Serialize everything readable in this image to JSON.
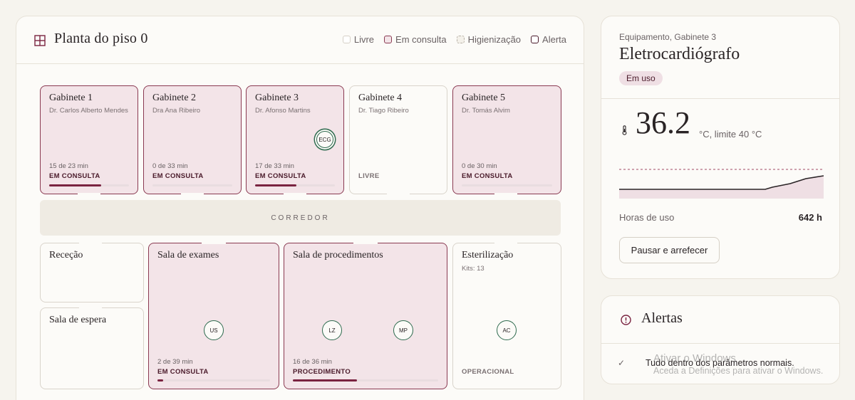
{
  "floor": {
    "title": "Planta do piso 0",
    "legend": [
      "Livre",
      "Em consulta",
      "Higienização",
      "Alerta"
    ],
    "corridor": "CORREDOR",
    "gabinetes": [
      {
        "name": "Gabinete 1",
        "doctor": "Dr. Carlos Alberto Mendes",
        "time": "15 de 23 min",
        "status": "EM CONSULTA",
        "progress": 0.65
      },
      {
        "name": "Gabinete 2",
        "doctor": "Dra Ana Ribeiro",
        "time": "0 de 33 min",
        "status": "EM CONSULTA",
        "progress": 0.0
      },
      {
        "name": "Gabinete 3",
        "doctor": "Dr. Afonso Martins",
        "time": "17 de 33 min",
        "status": "EM CONSULTA",
        "progress": 0.52,
        "badge": "ECG"
      },
      {
        "name": "Gabinete 4",
        "doctor": "Dr. Tiago Ribeiro",
        "time": "",
        "status": "LIVRE"
      },
      {
        "name": "Gabinete 5",
        "doctor": "Dr. Tomás Alvim",
        "time": "0 de 30 min",
        "status": "EM CONSULTA",
        "progress": 0.0
      }
    ],
    "rooms": {
      "rececao": "Receção",
      "sala_espera": "Sala de espera",
      "exames": {
        "name": "Sala de exames",
        "badge": "US",
        "time": "2 de 39 min",
        "status": "EM CONSULTA",
        "progress": 0.05
      },
      "procedimentos": {
        "name": "Sala de procedimentos",
        "badges": [
          "LZ",
          "MP"
        ],
        "time": "16 de 36 min",
        "status": "PROCEDIMENTO",
        "progress": 0.44
      },
      "esterilizacao": {
        "name": "Esterilização",
        "kits": "Kits: 13",
        "badge": "AC",
        "status": "OPERACIONAL"
      }
    }
  },
  "equipment": {
    "subtitle": "Equipamento, Gabinete 3",
    "name": "Eletrocardiógrafo",
    "status": "Em uso",
    "temperature": "36.2",
    "temp_unit": "°C, limite 40 °C",
    "temp_limit": 40,
    "hours_label": "Horas de uso",
    "hours_value": "642 h",
    "button": "Pausar e arrefecer"
  },
  "alerts": {
    "title": "Alertas",
    "message": "Tudo dentro dos parâmetros normais."
  },
  "watermark": {
    "line1": "Ativar o Windows",
    "line2": "Aceda a Definições para ativar o Windows."
  },
  "colors": {
    "busy_fill": "#f3e4e8",
    "busy_border": "#8a3a52",
    "accent": "#7a2340",
    "badge_ring": "#2f6b4f"
  }
}
